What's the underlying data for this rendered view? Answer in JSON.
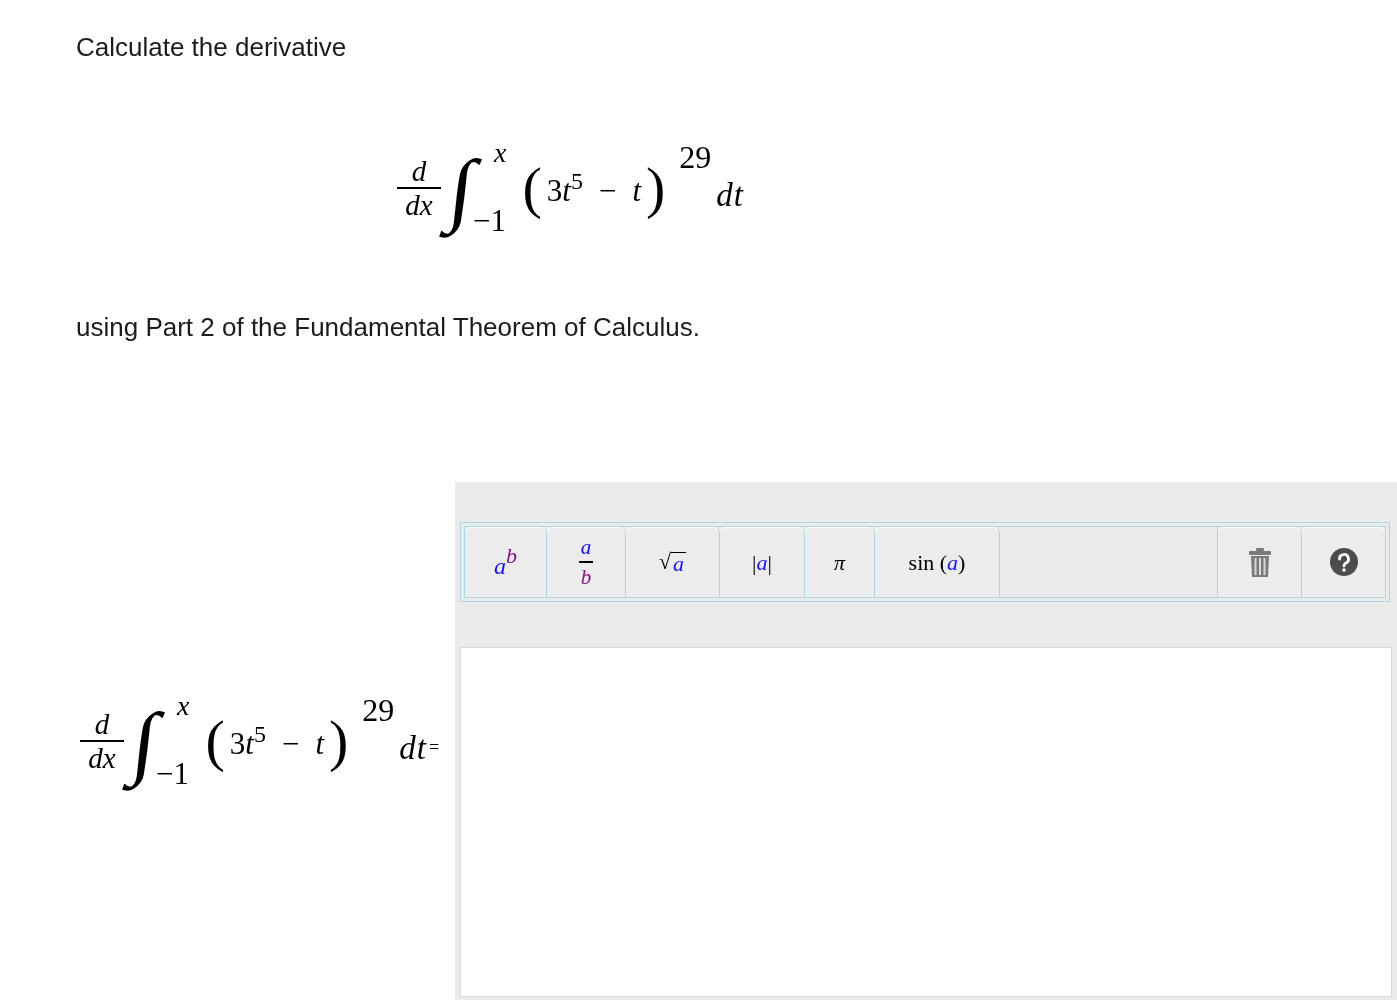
{
  "question": {
    "prompt": "Calculate the derivative",
    "expression": {
      "derivative": {
        "numerator": "d",
        "denominator": "dx"
      },
      "integral_sign": "∫",
      "upper_limit": "x",
      "lower_limit": "−1",
      "left_paren": "(",
      "integrand": {
        "coefficient": "3",
        "variable": "t",
        "power": "5",
        "operator": "−",
        "term": "t"
      },
      "right_paren": ")",
      "exponent": "29",
      "differential": "dt"
    },
    "instruction": "using Part 2 of the Fundamental Theorem of Calculus."
  },
  "answer": {
    "expression": {
      "derivative": {
        "numerator": "d",
        "denominator": "dx"
      },
      "integral_sign": "∫",
      "upper_limit": "x",
      "lower_limit": "−1",
      "left_paren": "(",
      "integrand": {
        "coefficient": "3",
        "variable": "t",
        "power": "5",
        "operator": "−",
        "term": "t"
      },
      "right_paren": ")",
      "exponent": "29",
      "differential": "dt"
    },
    "equals": "="
  },
  "editor": {
    "toolbar": [
      {
        "kind": "power",
        "base": "a",
        "exponent": "b"
      },
      {
        "kind": "fraction",
        "numerator": "a",
        "denominator": "b"
      },
      {
        "kind": "root",
        "symbol": "√",
        "radicand": "a"
      },
      {
        "kind": "absolute",
        "left": "|",
        "argument": "a",
        "right": "|"
      },
      {
        "kind": "symbol",
        "symbol": "π"
      },
      {
        "kind": "function",
        "name": "sin",
        "open": "(",
        "argument": "a",
        "close": ")"
      }
    ]
  }
}
